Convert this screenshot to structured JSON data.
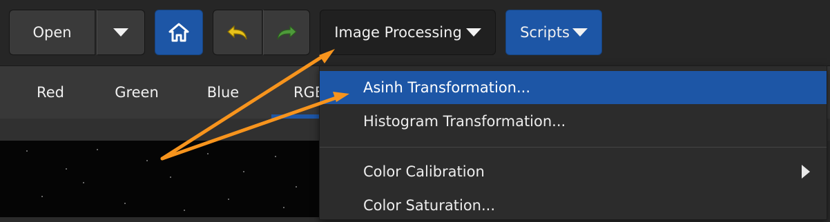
{
  "toolbar": {
    "open_label": "Open",
    "image_processing_label": "Image Processing",
    "scripts_label": "Scripts",
    "home_icon": "home-icon",
    "undo_icon": "undo-icon",
    "redo_icon": "redo-icon"
  },
  "tabs": [
    {
      "label": "Red"
    },
    {
      "label": "Green"
    },
    {
      "label": "Blue"
    },
    {
      "label": "RGB"
    }
  ],
  "menu": {
    "items": [
      {
        "label": "Asinh Transformation...",
        "selected": true
      },
      {
        "label": "Histogram Transformation...",
        "selected": false
      },
      {
        "label": "Color Calibration",
        "has_submenu": true
      },
      {
        "label": "Color Saturation...",
        "selected": false
      }
    ]
  },
  "colors": {
    "accent": "#1d56a6",
    "annotation_arrow": "#f7941d",
    "undo": "#e8c21a",
    "redo": "#4e9a3a"
  }
}
